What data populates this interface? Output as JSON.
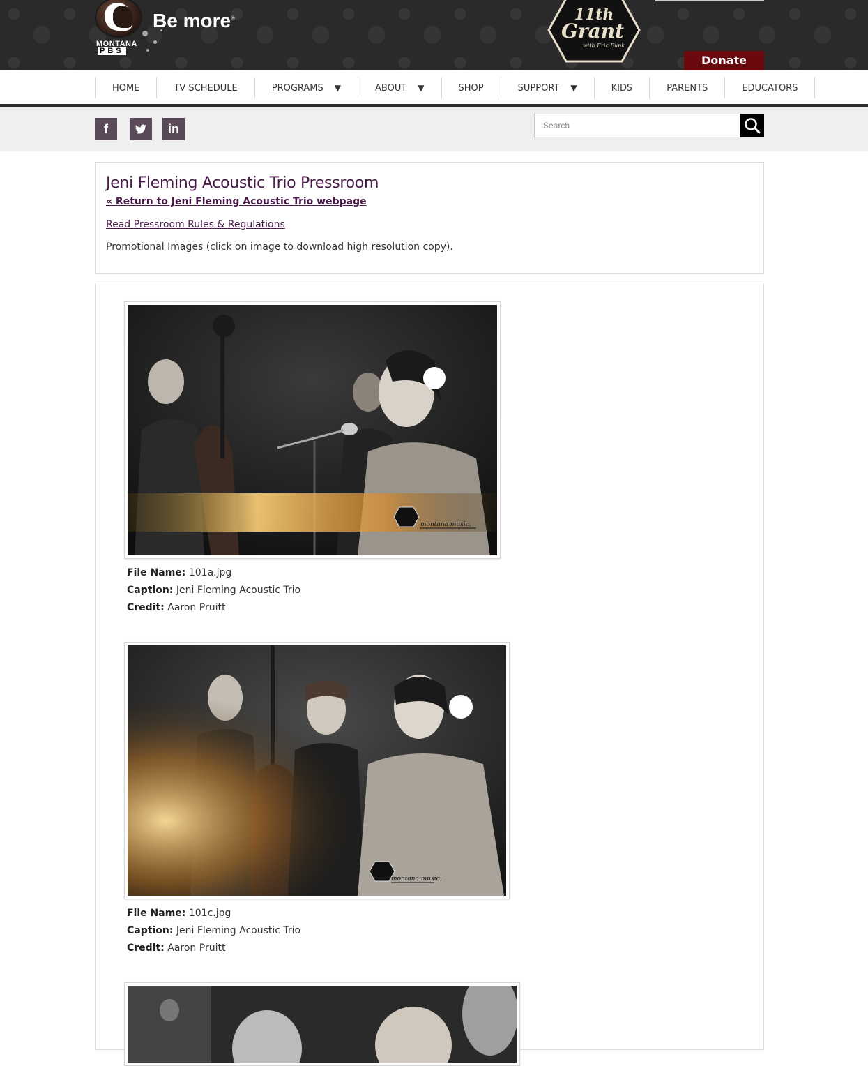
{
  "header": {
    "pbs_logo_text": "MONTANA",
    "pbs_letters": "PBS",
    "tagline": "Be more",
    "show_logo_text": "11th & Grant",
    "show_logo_sub": "with Eric Funk",
    "donate_label": "Donate"
  },
  "nav": {
    "items": [
      {
        "label": "HOME",
        "has_dropdown": false
      },
      {
        "label": "TV SCHEDULE",
        "has_dropdown": false
      },
      {
        "label": "PROGRAMS",
        "has_dropdown": true
      },
      {
        "label": "ABOUT",
        "has_dropdown": true
      },
      {
        "label": "SHOP",
        "has_dropdown": false
      },
      {
        "label": "SUPPORT",
        "has_dropdown": true
      },
      {
        "label": "KIDS",
        "has_dropdown": false
      },
      {
        "label": "PARENTS",
        "has_dropdown": false
      },
      {
        "label": "EDUCATORS",
        "has_dropdown": false
      }
    ],
    "caret": "▼"
  },
  "social": {
    "facebook": "f",
    "twitter": "twitter-icon",
    "linkedin": "in"
  },
  "search": {
    "placeholder": "Search"
  },
  "intro": {
    "title": "Jeni Fleming Acoustic Trio Pressroom",
    "return_link": "« Return to Jeni Fleming Acoustic Trio webpage",
    "rules_link": "Read Pressroom Rules & Regulations",
    "promo_text": "Promotional Images (click on image to download high resolution copy)."
  },
  "labels": {
    "file_name": "File Name:",
    "caption": "Caption:",
    "credit": "Credit:"
  },
  "images": [
    {
      "file_name": "101a.jpg",
      "caption": "Jeni Fleming Acoustic Trio",
      "credit": "Aaron Pruitt",
      "watermark": "montana music."
    },
    {
      "file_name": "101c.jpg",
      "caption": "Jeni Fleming Acoustic Trio",
      "credit": "Aaron Pruitt",
      "watermark": "montana music."
    }
  ],
  "colors": {
    "banner": "#2b2a2b",
    "donate": "#6b0a0e",
    "title": "#4a1a4a",
    "social": "#5a4a58"
  }
}
